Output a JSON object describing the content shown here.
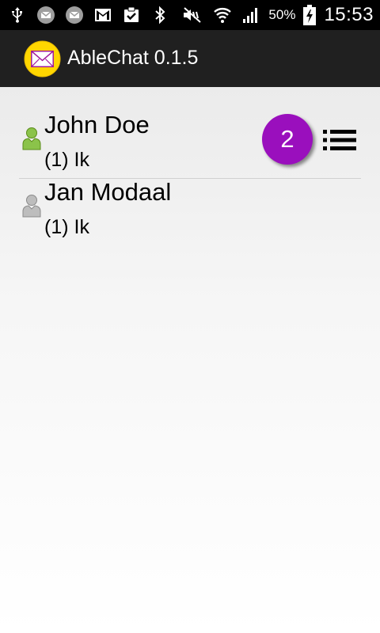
{
  "status_bar": {
    "icons": [
      "usb-icon",
      "email-icon",
      "email-icon",
      "gmail-icon",
      "task-icon",
      "bluetooth-icon",
      "mute-icon",
      "wifi-icon",
      "signal-icon",
      "battery-charging-icon"
    ],
    "battery": "50%",
    "time": "15:53"
  },
  "action_bar": {
    "title": "AbleChat 0.1.5",
    "logo": "envelope-icon"
  },
  "contacts": [
    {
      "name": "John Doe",
      "status": "(1) Ik",
      "presence": "online",
      "presence_color": "#8bc34a",
      "unread": "2"
    },
    {
      "name": "Jan Modaal",
      "status": "(1) Ik",
      "presence": "offline",
      "presence_color": "#bdbdbd"
    }
  ],
  "colors": {
    "badge": "#9a0fbd",
    "actionbar": "#202020",
    "logo_circle": "#ffd600",
    "envelope_accent": "#a0179c"
  }
}
